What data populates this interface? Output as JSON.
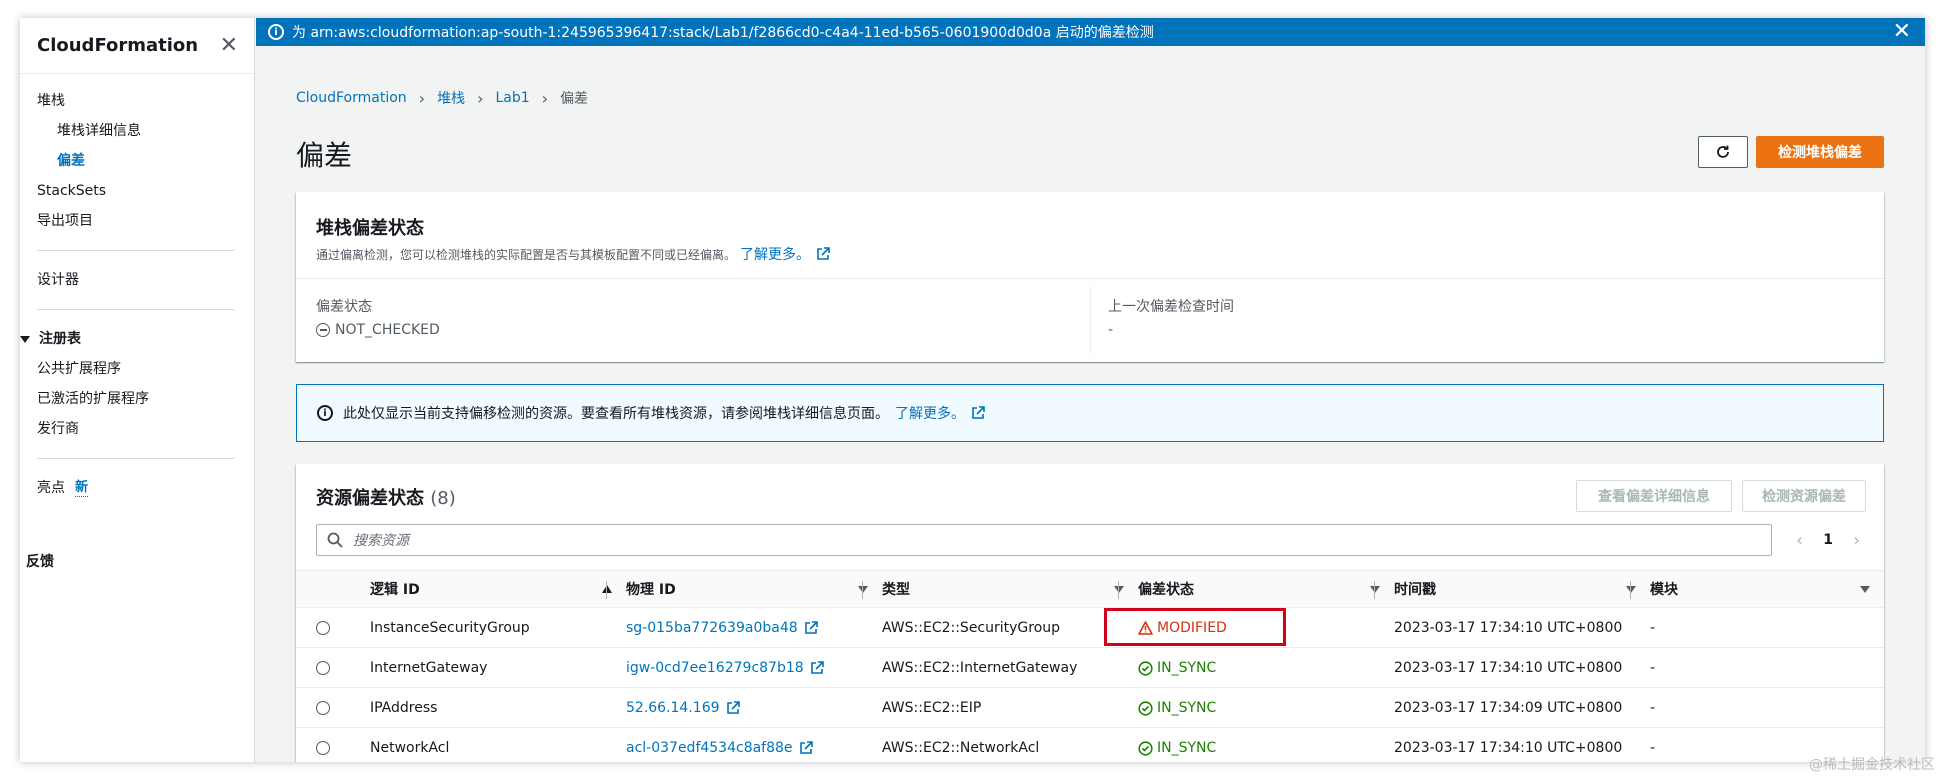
{
  "sidebar": {
    "title": "CloudFormation",
    "items": [
      {
        "label": "堆栈",
        "type": "item"
      },
      {
        "label": "堆栈详细信息",
        "type": "sub"
      },
      {
        "label": "偏差",
        "type": "sub-active"
      },
      {
        "label": "StackSets",
        "type": "item"
      },
      {
        "label": "导出项目",
        "type": "item"
      }
    ],
    "designer": "设计器",
    "registry_group": "注册表",
    "registry_items": [
      "公共扩展程序",
      "已激活的扩展程序",
      "发行商"
    ],
    "highlights": "亮点",
    "new_badge": "新",
    "feedback": "反馈"
  },
  "flash": {
    "message": "为 arn:aws:cloudformation:ap-south-1:245965396417:stack/Lab1/f2866cd0-c4a4-11ed-b565-0601900d0d0a 启动的偏差检测"
  },
  "breadcrumb": [
    "CloudFormation",
    "堆栈",
    "Lab1",
    "偏差"
  ],
  "page": {
    "title": "偏差",
    "detect_stack_drift": "检测堆栈偏差"
  },
  "stack_drift": {
    "title": "堆栈偏差状态",
    "description": "通过偏离检测，您可以检测堆栈的实际配置是否与其模板配置不同或已经偏离。",
    "learn_more": "了解更多。",
    "status_label": "偏差状态",
    "status_value": "NOT_CHECKED",
    "last_check_label": "上一次偏差检查时间",
    "last_check_value": "-"
  },
  "alert": {
    "text": "此处仅显示当前支持偏移检测的资源。要查看所有堆栈资源，请参阅堆栈详细信息页面。",
    "learn_more": "了解更多。"
  },
  "resources": {
    "title": "资源偏差状态",
    "count": "(8)",
    "view_details": "查看偏差详细信息",
    "detect_resource": "检测资源偏差",
    "search_placeholder": "搜索资源",
    "page": "1",
    "columns": [
      "逻辑 ID",
      "物理 ID",
      "类型",
      "偏差状态",
      "时间戳",
      "模块"
    ],
    "rows": [
      {
        "logical_id": "InstanceSecurityGroup",
        "physical_id": "sg-015ba772639a0ba48",
        "type": "AWS::EC2::SecurityGroup",
        "status": "MODIFIED",
        "timestamp": "2023-03-17 17:34:10 UTC+0800",
        "module": "-"
      },
      {
        "logical_id": "InternetGateway",
        "physical_id": "igw-0cd7ee16279c87b18",
        "type": "AWS::EC2::InternetGateway",
        "status": "IN_SYNC",
        "timestamp": "2023-03-17 17:34:10 UTC+0800",
        "module": "-"
      },
      {
        "logical_id": "IPAddress",
        "physical_id": "52.66.14.169",
        "type": "AWS::EC2::EIP",
        "status": "IN_SYNC",
        "timestamp": "2023-03-17 17:34:09 UTC+0800",
        "module": "-"
      },
      {
        "logical_id": "NetworkAcl",
        "physical_id": "acl-037edf4534c8af88e",
        "type": "AWS::EC2::NetworkAcl",
        "status": "IN_SYNC",
        "timestamp": "2023-03-17 17:34:10 UTC+0800",
        "module": "-"
      }
    ]
  },
  "watermark": "@稀土掘金技术社区",
  "colors": {
    "accent": "#0073bb",
    "primary_button": "#ec7211",
    "in_sync": "#1d8102",
    "modified": "#d13212",
    "highlight": "#d0021b"
  }
}
